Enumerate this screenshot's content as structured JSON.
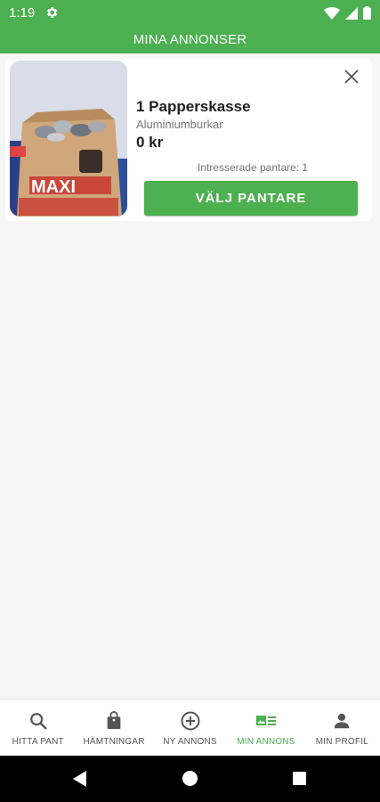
{
  "status": {
    "time": "1:19"
  },
  "app_bar": {
    "title": "MINA ANNONSER"
  },
  "listing": {
    "title": "1 Papperskasse",
    "subtitle": "Aluminiumburkar",
    "price": "0 kr",
    "interested": "Intresserade pantare: 1",
    "select_button": "VÄLJ PANTARE",
    "image_text": "MAXI"
  },
  "bottom_nav": [
    {
      "label": "HITTA PANT",
      "icon": "search-icon",
      "active": false
    },
    {
      "label": "HÄMTNINGAR",
      "icon": "shopping-bag-icon",
      "active": false
    },
    {
      "label": "NY ANNONS",
      "icon": "add-circle-icon",
      "active": false
    },
    {
      "label": "MIN ANNONS",
      "icon": "listing-card-icon",
      "active": true
    },
    {
      "label": "MIN PROFIL",
      "icon": "person-icon",
      "active": false
    }
  ],
  "colors": {
    "primary": "#4caf50",
    "active_nav": "#4caf50",
    "inactive_nav": "#555555"
  }
}
